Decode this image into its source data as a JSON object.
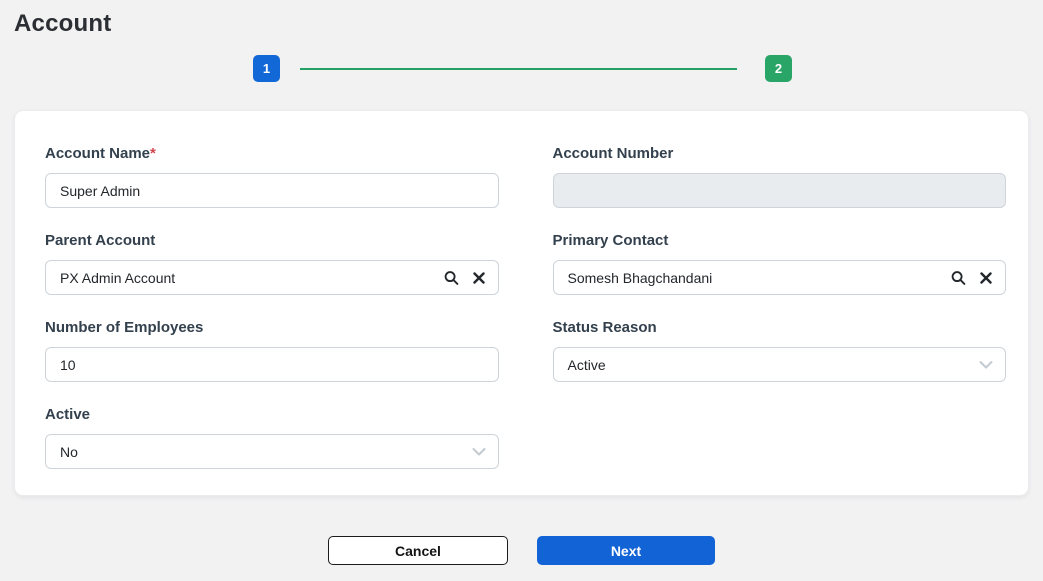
{
  "page": {
    "title": "Account",
    "background_color": "#f2f2f3"
  },
  "stepper": {
    "steps": [
      {
        "label": "1",
        "color": "#1168d6",
        "state": "current"
      },
      {
        "label": "2",
        "color": "#2aa568",
        "state": "upcoming"
      }
    ],
    "line_color": "#24a164"
  },
  "form": {
    "account_name": {
      "label": "Account Name",
      "required_marker": "*",
      "value": "Super Admin"
    },
    "account_number": {
      "label": "Account Number",
      "value": "",
      "disabled": true
    },
    "parent_account": {
      "label": "Parent Account",
      "value": "PX Admin Account",
      "icons": [
        "search-icon",
        "clear-icon"
      ]
    },
    "primary_contact": {
      "label": "Primary Contact",
      "value": "Somesh Bhagchandani",
      "icons": [
        "search-icon",
        "clear-icon"
      ]
    },
    "number_of_employees": {
      "label": "Number of Employees",
      "value": "10"
    },
    "status_reason": {
      "label": "Status Reason",
      "value": "Active"
    },
    "active": {
      "label": "Active",
      "value": "No"
    }
  },
  "footer": {
    "cancel_label": "Cancel",
    "next_label": "Next"
  },
  "colors": {
    "primary_blue": "#1263d6",
    "step_blue": "#1168d6",
    "step_green": "#2aa568",
    "line_green": "#24a164",
    "required_red": "#d0454c",
    "label_color": "#33404d",
    "disabled_input_bg": "#e9ecef",
    "input_border": "#ced4da"
  }
}
